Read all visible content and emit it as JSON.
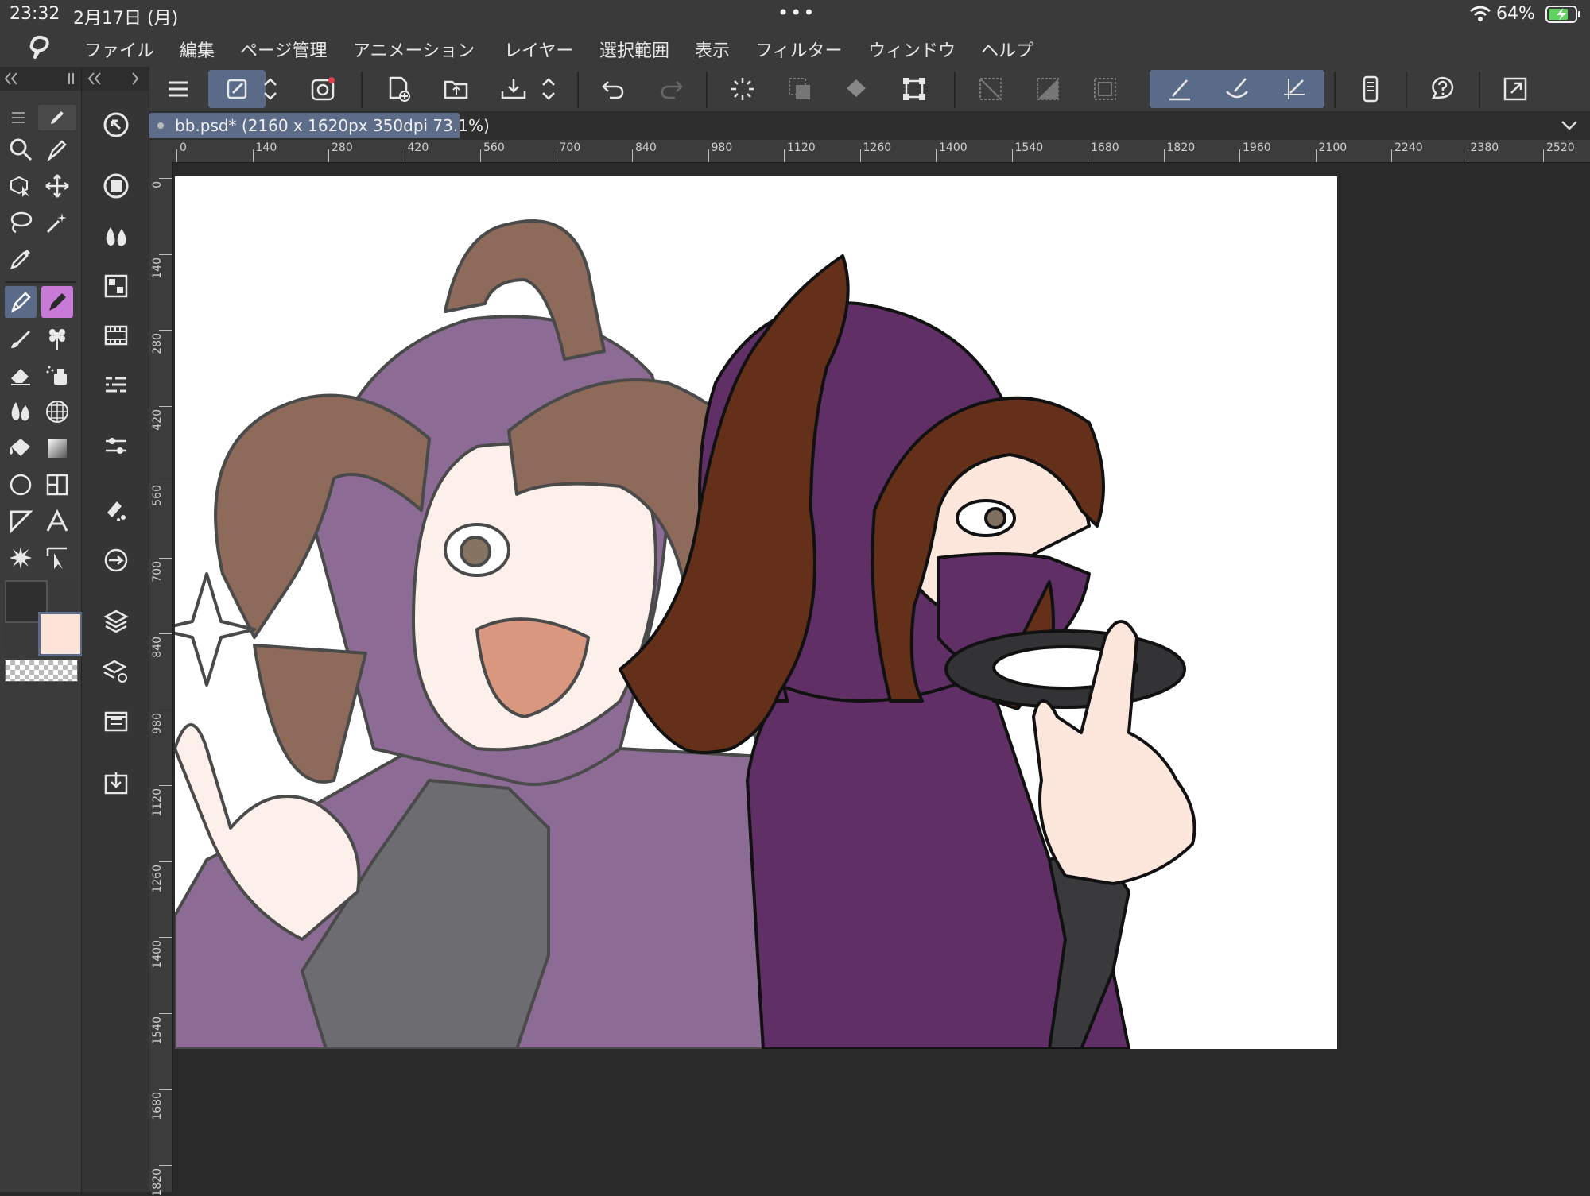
{
  "status": {
    "time": "23:32",
    "date": "2月17日 (月)",
    "dots": "•••",
    "battery": "64%"
  },
  "menu": {
    "items": [
      "ファイル",
      "編集",
      "ページ管理",
      "アニメーション",
      "レイヤー",
      "選択範囲",
      "表示",
      "フィルター",
      "ウィンドウ",
      "ヘルプ"
    ]
  },
  "document": {
    "tab_label": "bb.psd* (2160 x 1620px 350dpi 73.1%)"
  },
  "ruler": {
    "h_labels": [
      "0",
      "140",
      "280",
      "420",
      "560",
      "700",
      "840",
      "980",
      "1120",
      "1260",
      "1400",
      "1540",
      "1680",
      "1820",
      "1960",
      "2100",
      "2240",
      "2380",
      "2520"
    ],
    "v_labels": [
      "0",
      "140",
      "280",
      "420",
      "560",
      "700",
      "840",
      "980",
      "1120",
      "1260",
      "1400",
      "1540",
      "1680",
      "1820"
    ]
  },
  "colors": {
    "main": "#2f2f2f",
    "sub": "#fde4d8",
    "accent": "#5a6b8a"
  },
  "icons": {
    "tools_left": [
      "zoom-icon",
      "pen-tip-icon",
      "object-select-icon",
      "move-icon",
      "lasso-icon",
      "magic-wand-icon",
      "eyedropper-icon",
      "pen-icon",
      "marker-icon",
      "brush-icon",
      "decoration-icon",
      "eraser-icon",
      "airbrush-icon",
      "blend-icon",
      "perspective-icon",
      "fill-icon",
      "gradient-icon",
      "shape-icon",
      "frame-icon",
      "balloon-icon",
      "text-icon",
      "burst-icon",
      "correct-line-icon"
    ],
    "tools_mid": [
      "navigator-icon",
      "sub-view-icon",
      "color-wheel-icon",
      "material-icon",
      "timeline-icon",
      "layer-property-icon",
      "tool-property-icon",
      "brush-size-icon",
      "auto-action-icon",
      "layer-icon",
      "layer-search-icon",
      "page-manage-icon",
      "export-icon"
    ]
  }
}
